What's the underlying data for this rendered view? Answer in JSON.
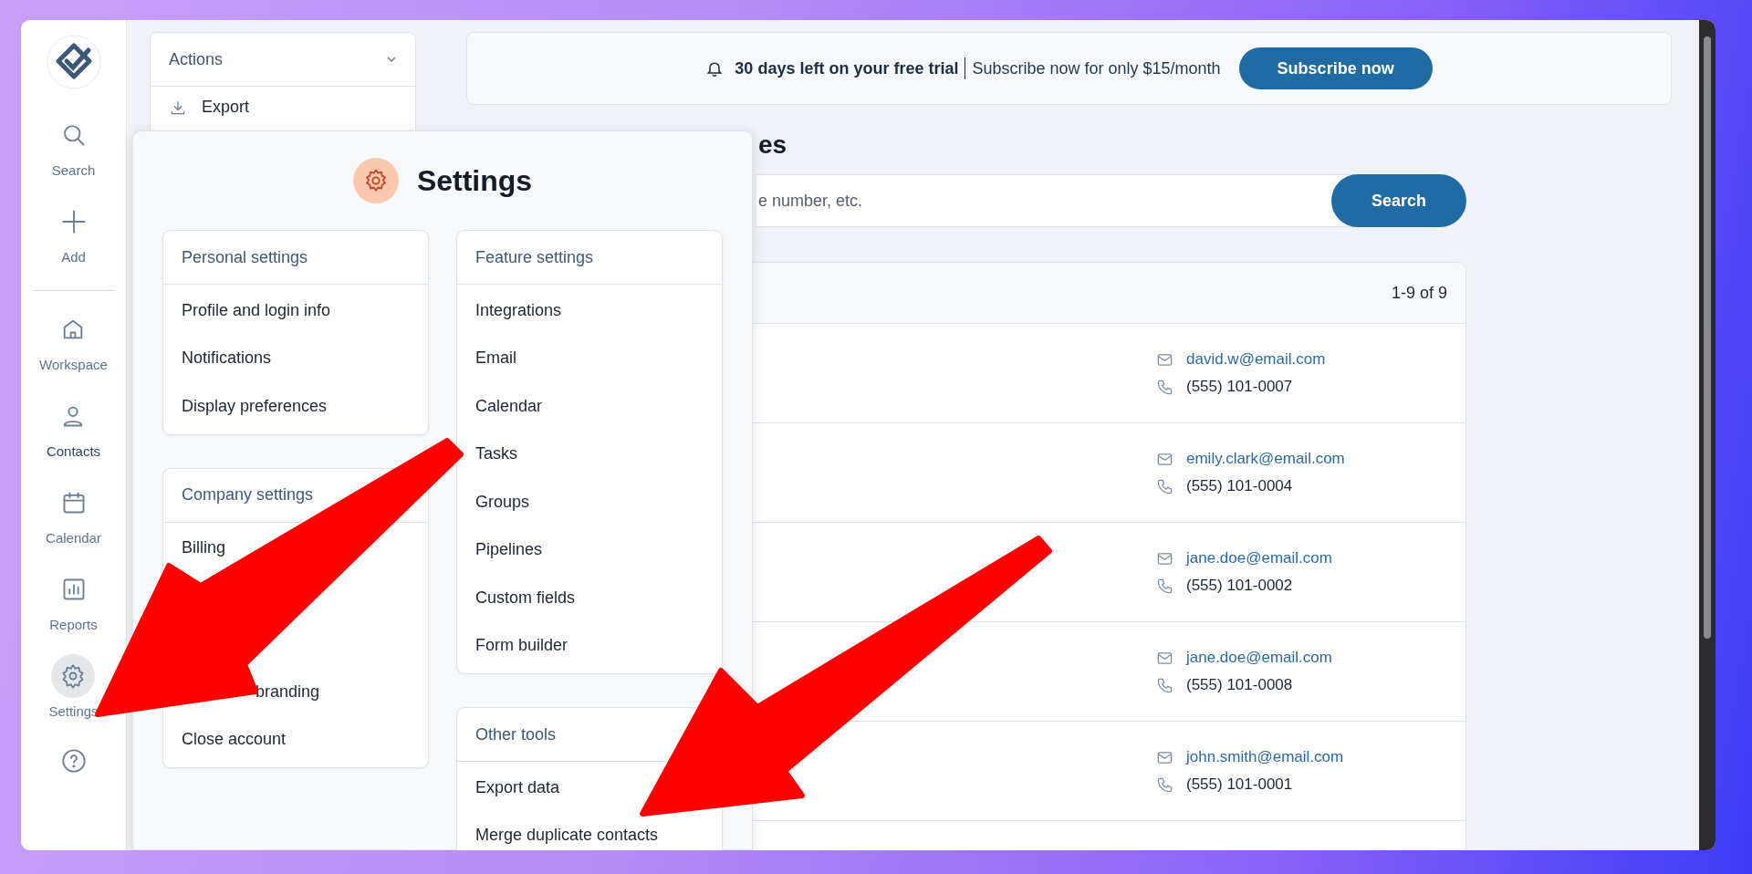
{
  "sidebar": {
    "items": [
      {
        "label": "Search",
        "selected": false,
        "open": false
      },
      {
        "label": "Add",
        "selected": false,
        "open": false
      },
      {
        "kind": "divider"
      },
      {
        "label": "Workspace",
        "selected": false,
        "open": false
      },
      {
        "label": "Contacts",
        "selected": true,
        "open": false
      },
      {
        "label": "Calendar",
        "selected": false,
        "open": false
      },
      {
        "label": "Reports",
        "selected": false,
        "open": false
      },
      {
        "label": "Settings",
        "selected": false,
        "open": true
      }
    ]
  },
  "actions": {
    "title": "Actions",
    "items": [
      {
        "label": "Export"
      }
    ]
  },
  "trial_banner": {
    "message": "30 days left on your free trial",
    "offer": "Subscribe now for only $15/month",
    "button": "Subscribe now"
  },
  "page_title": "es",
  "search": {
    "placeholder": "e number, etc.",
    "button": "Search"
  },
  "contacts": {
    "count": "1-9 of 9",
    "rows": [
      {
        "email": "david.w@email.com",
        "phone": "(555) 101-0007"
      },
      {
        "email": "emily.clark@email.com",
        "phone": "(555) 101-0004"
      },
      {
        "email": "jane.doe@email.com",
        "phone": "(555) 101-0002"
      },
      {
        "email": "jane.doe@email.com",
        "phone": "(555) 101-0008"
      },
      {
        "email": "john.smith@email.com",
        "phone": "(555) 101-0001"
      }
    ]
  },
  "settings_panel": {
    "title": "Settings",
    "columns": [
      [
        {
          "title": "Personal settings",
          "items": [
            {
              "label": "Profile and login info",
              "covered": false
            },
            {
              "label": "Notifications",
              "covered": false
            },
            {
              "label": "Display preferences",
              "covered": false
            }
          ]
        },
        {
          "title": "Company settings",
          "items": [
            {
              "label": "Billing",
              "covered": false
            },
            {
              "label": "branding",
              "covered": true
            },
            {
              "label": "Close account",
              "covered": false
            }
          ]
        }
      ],
      [
        {
          "title": "Feature settings",
          "items": [
            {
              "label": "Integrations",
              "covered": false
            },
            {
              "label": "Email",
              "covered": false
            },
            {
              "label": "Calendar",
              "covered": false
            },
            {
              "label": "Tasks",
              "covered": false
            },
            {
              "label": "Groups",
              "covered": false
            },
            {
              "label": "Pipelines",
              "covered": false
            },
            {
              "label": "Custom fields",
              "covered": false
            },
            {
              "label": "Form builder",
              "covered": false
            }
          ]
        },
        {
          "title": "Other tools",
          "items": [
            {
              "label": "Export data",
              "covered": false
            },
            {
              "label": "Merge duplicate contacts",
              "covered": false
            }
          ]
        }
      ]
    ]
  },
  "annotations": [
    {
      "kind": "arrow"
    },
    {
      "kind": "arrow"
    }
  ]
}
